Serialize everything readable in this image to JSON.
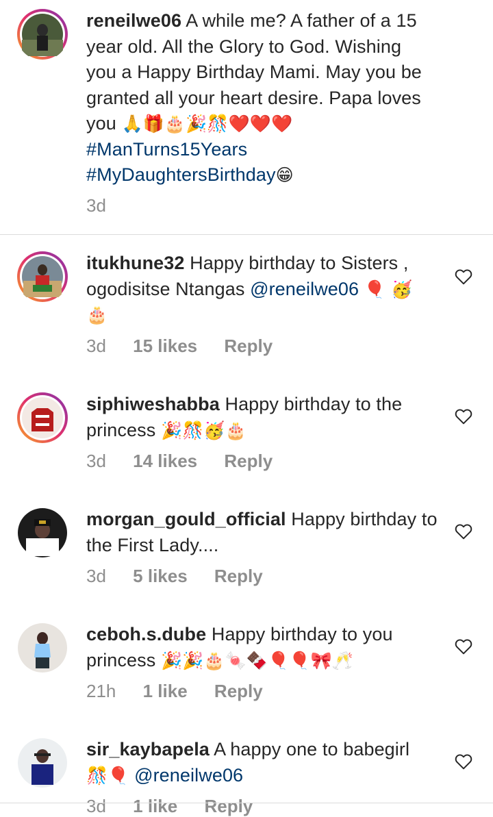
{
  "caption": {
    "username": "reneilwe06",
    "line1": "A while me? A father of a 15",
    "line2": "year old. All the Glory to God. Wishing",
    "line3": "you a Happy Birthday Mami. May you be",
    "line4": "granted all your heart desire. Papa loves",
    "line5": "you",
    "emojis_line5": "🙏🎁🎂🎉🎊❤️❤️❤️",
    "hashtag1": "#ManTurns15Years",
    "hashtag2": "#MyDaughtersBirthday",
    "hashtag2_emoji": "😁",
    "time": "3d"
  },
  "comments": [
    {
      "username": "itukhune32",
      "text_line1": "Happy birthday  to Sisters ,",
      "text_line2": "ogodisitse Ntangas",
      "mention": "@reneilwe06",
      "emojis_line2": "🎈 🥳",
      "emojis_line3": "🎂",
      "time": "3d",
      "likes": "15 likes",
      "reply": "Reply"
    },
    {
      "username": "siphiweshabba",
      "text_line1": "Happy birthday to the",
      "text_line2": "princess",
      "emojis_line2": "🎉🎊🥳🎂",
      "time": "3d",
      "likes": "14 likes",
      "reply": "Reply"
    },
    {
      "username": "morgan_gould_official",
      "text_line1": "Happy birthday to",
      "text_line2": "the First Lady....",
      "time": "3d",
      "likes": "5 likes",
      "reply": "Reply"
    },
    {
      "username": "ceboh.s.dube",
      "text_line1": "Happy birthday to you",
      "text_line2": "princess",
      "emojis_line2": "🎉🎉🎂🍬🍫🎈🎈🎀🥂",
      "time": "21h",
      "likes": "1 like",
      "reply": "Reply"
    },
    {
      "username": "sir_kaybapela",
      "text_line1": "A happy one to babegirl",
      "emojis_line2": "🎊🎈",
      "mention": "@reneilwe06",
      "time": "3d",
      "likes": "1 like",
      "reply": "Reply"
    }
  ],
  "icons": {
    "heart": "heart-outline-icon",
    "avatar": "avatar"
  },
  "colors": {
    "link": "#00376b",
    "text": "#262626",
    "meta": "#8e8e8e",
    "divider": "#dbdbdb"
  }
}
